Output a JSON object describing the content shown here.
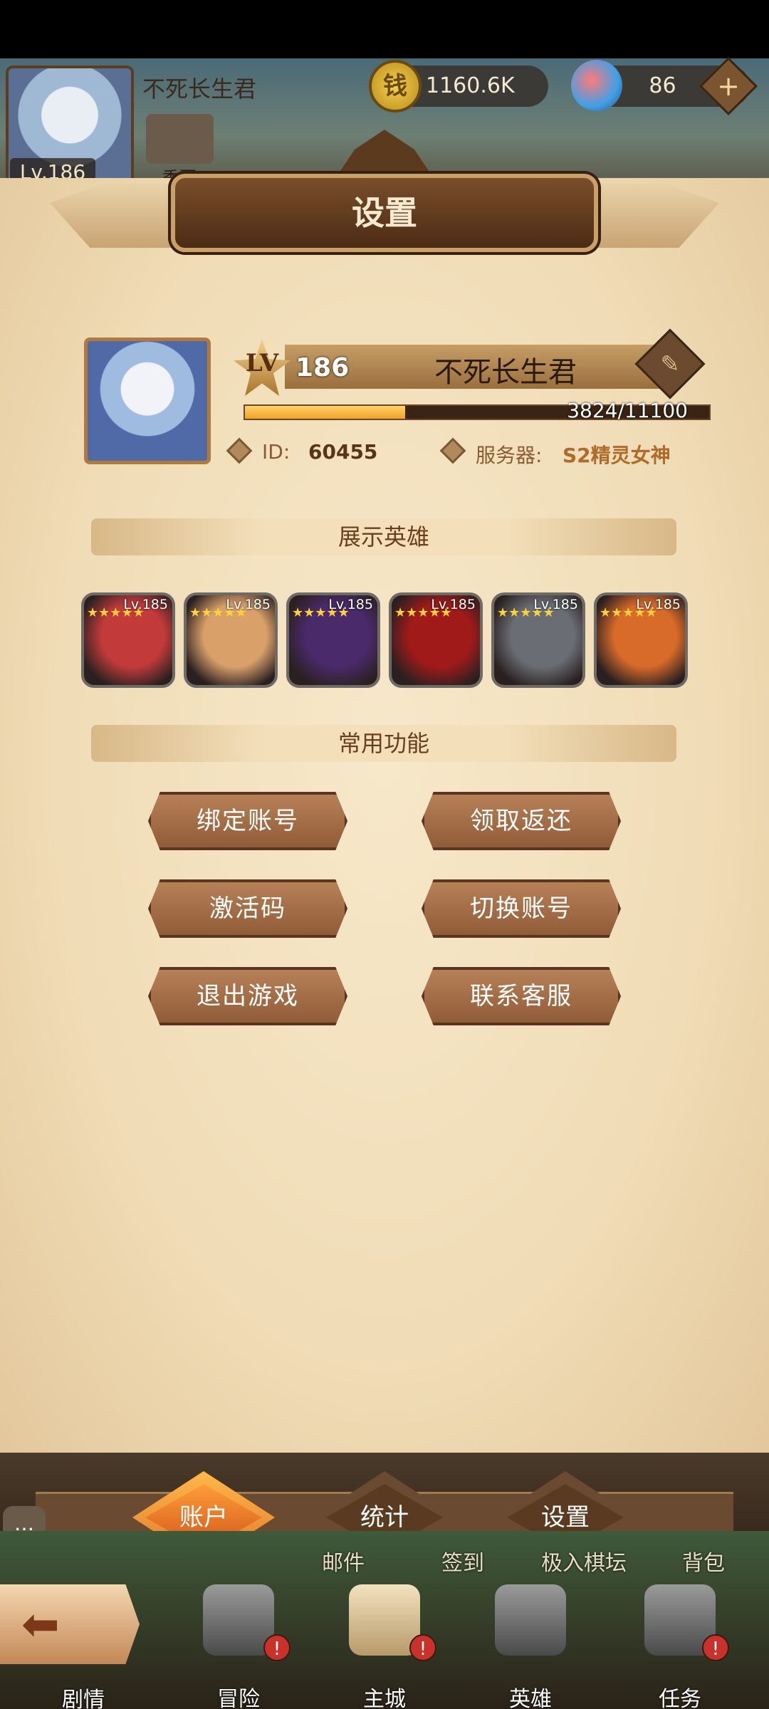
{
  "top": {
    "player_level": "Lv.186",
    "player_name": "不死长生君",
    "coins": "1160.6K",
    "gems": "86",
    "season_label": "季票",
    "plus": "+"
  },
  "dialog": {
    "title": "设置"
  },
  "profile": {
    "lv_label": "LV",
    "level": "186",
    "name": "不死长生君",
    "xp_text": "3824/11100",
    "xp_progress": 0.3445,
    "id_label": "ID:",
    "id_value": "60455",
    "server_label": "服务器:",
    "server_value": "S2精灵女神"
  },
  "showcase": {
    "title": "展示英雄",
    "heroes": [
      {
        "level": "Lv.185",
        "stars": "★★★★★",
        "color": "#c23a3a"
      },
      {
        "level": "Lv.185",
        "stars": "★★★★★",
        "color": "#d9a06a"
      },
      {
        "level": "Lv.185",
        "stars": "★★★★★",
        "color": "#4a2a6a"
      },
      {
        "level": "Lv.185",
        "stars": "★★★★★",
        "color": "#a01a1a"
      },
      {
        "level": "Lv.185",
        "stars": "★★★★★",
        "color": "#6a6e74"
      },
      {
        "level": "Lv.185",
        "stars": "★★★★★",
        "color": "#d86a2a"
      }
    ]
  },
  "functions": {
    "title": "常用功能",
    "bind_account": "绑定账号",
    "claim_rebate": "领取返还",
    "activation_code": "激活码",
    "switch_account": "切换账号",
    "exit_game": "退出游戏",
    "contact_support": "联系客服"
  },
  "tabs": {
    "account": "账户",
    "stats": "统计",
    "settings": "设置"
  },
  "sub_nav": {
    "mail": "邮件",
    "sign_in": "签到",
    "chess": "极入棋坛",
    "bag": "背包"
  },
  "nav": {
    "story": "剧情",
    "adventure": "冒险",
    "main_city": "主城",
    "heroes": "英雄",
    "tasks": "任务",
    "alert_mark": "!"
  },
  "colors": {
    "accent": "#f0a22a",
    "panel": "#f0dcb6",
    "button": "#8e5a36"
  }
}
